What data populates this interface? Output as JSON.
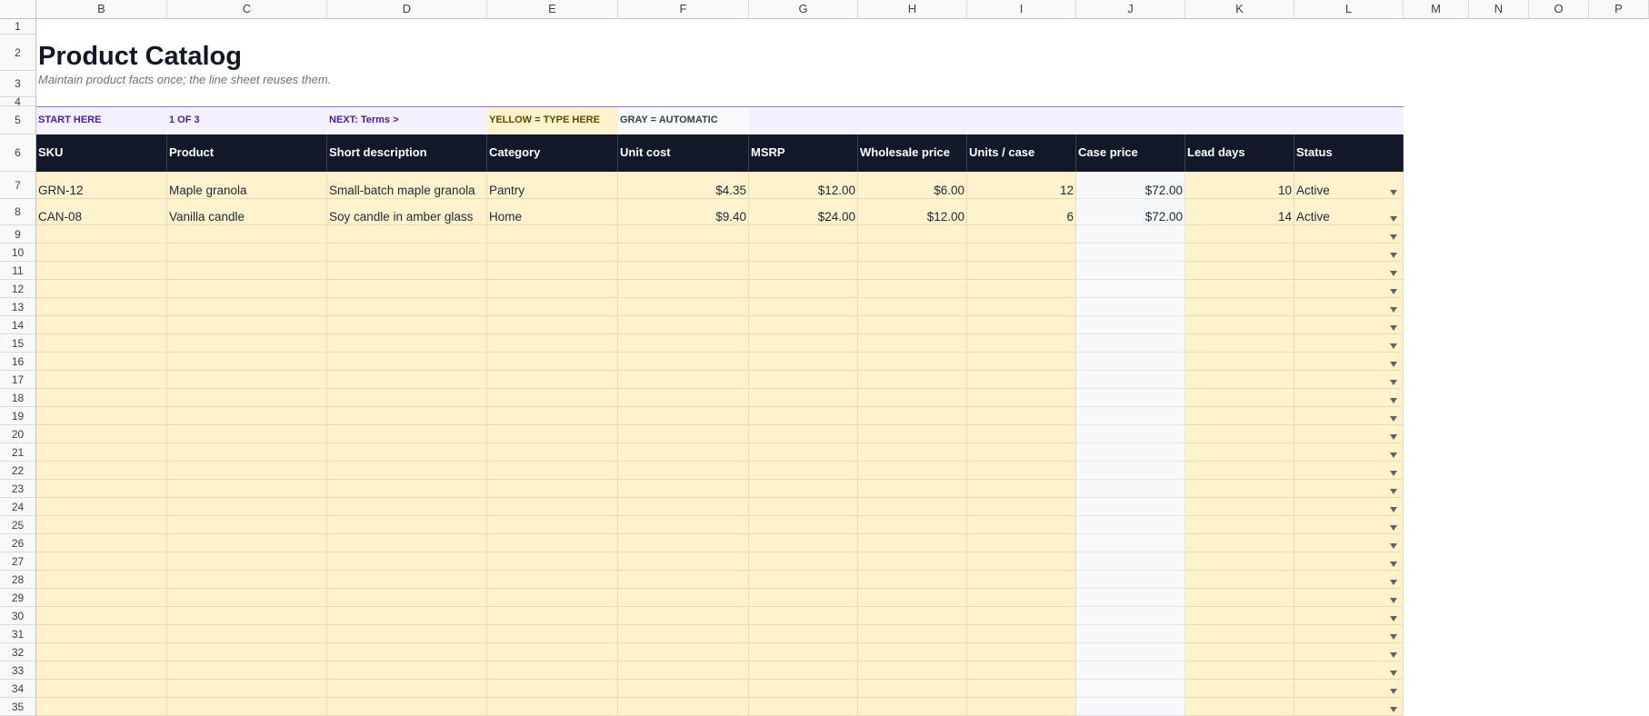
{
  "columns": [
    "B",
    "C",
    "D",
    "E",
    "F",
    "G",
    "H",
    "I",
    "J",
    "K",
    "L",
    "M",
    "N",
    "O",
    "P"
  ],
  "title": "Product Catalog",
  "subtitle": "Maintain product facts once; the line sheet reuses them.",
  "nav": {
    "start": "START HERE",
    "step": "1 OF 3",
    "next": "NEXT: Terms  >",
    "legend_yellow": "YELLOW = TYPE HERE",
    "legend_gray": "GRAY = AUTOMATIC"
  },
  "headers": [
    "SKU",
    "Product",
    "Short description",
    "Category",
    "Unit cost",
    "MSRP",
    "Wholesale price",
    "Units / case",
    "Case price",
    "Lead days",
    "Status"
  ],
  "rows": [
    [
      "GRN-12",
      "Maple granola",
      "Small-batch maple granola",
      "Pantry",
      "$4.35",
      "$12.00",
      "$6.00",
      "12",
      "$72.00",
      "10",
      "Active"
    ],
    [
      "CAN-08",
      "Vanilla candle",
      "Soy candle in amber glass",
      "Home",
      "$9.40",
      "$24.00",
      "$12.00",
      "6",
      "$72.00",
      "14",
      "Active"
    ]
  ],
  "row_numbers": [
    "1",
    "2",
    "3",
    "4",
    "5",
    "6",
    "7",
    "8",
    "9",
    "10",
    "11",
    "12",
    "13",
    "14",
    "15",
    "16",
    "17",
    "18",
    "19",
    "20",
    "21",
    "22",
    "23",
    "24",
    "25",
    "26",
    "27",
    "28",
    "29",
    "30",
    "31",
    "32",
    "33",
    "34",
    "35"
  ],
  "colors": {
    "input_fill": "#fff2cc",
    "auto_fill": "#f7f8fa",
    "header_fill": "#111827",
    "nav_band": "#f3f1fd",
    "nav_text": "#4c1d95"
  }
}
